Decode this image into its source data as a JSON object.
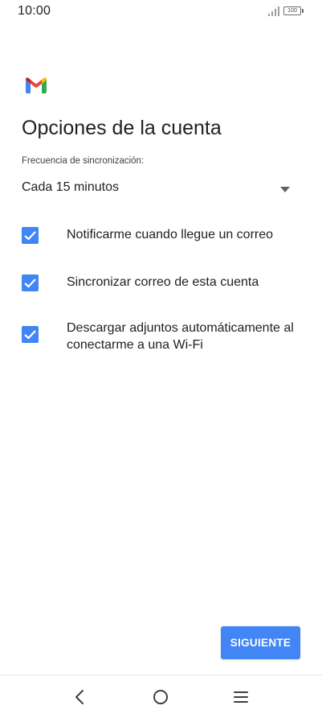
{
  "status_bar": {
    "time": "10:00",
    "battery": "100"
  },
  "header": {
    "logo_icon": "gmail-logo-icon",
    "title": "Opciones de la cuenta"
  },
  "sync": {
    "label": "Frecuencia de sincronización:",
    "selected": "Cada 15 minutos"
  },
  "options": [
    {
      "label": "Notificarme cuando llegue un correo",
      "checked": true
    },
    {
      "label": "Sincronizar correo de esta cuenta",
      "checked": true
    },
    {
      "label": "Descargar adjuntos automáticamente al conectarme a una Wi-Fi",
      "checked": true
    }
  ],
  "actions": {
    "next_label": "SIGUIENTE"
  },
  "navigation": {
    "back_icon": "back-icon",
    "home_icon": "home-icon",
    "menu_icon": "menu-icon"
  },
  "colors": {
    "accent": "#4285f4",
    "gmail_red": "#ea4335",
    "gmail_yellow": "#fbbc04",
    "gmail_green": "#34a853",
    "gmail_blue": "#4285f4"
  }
}
